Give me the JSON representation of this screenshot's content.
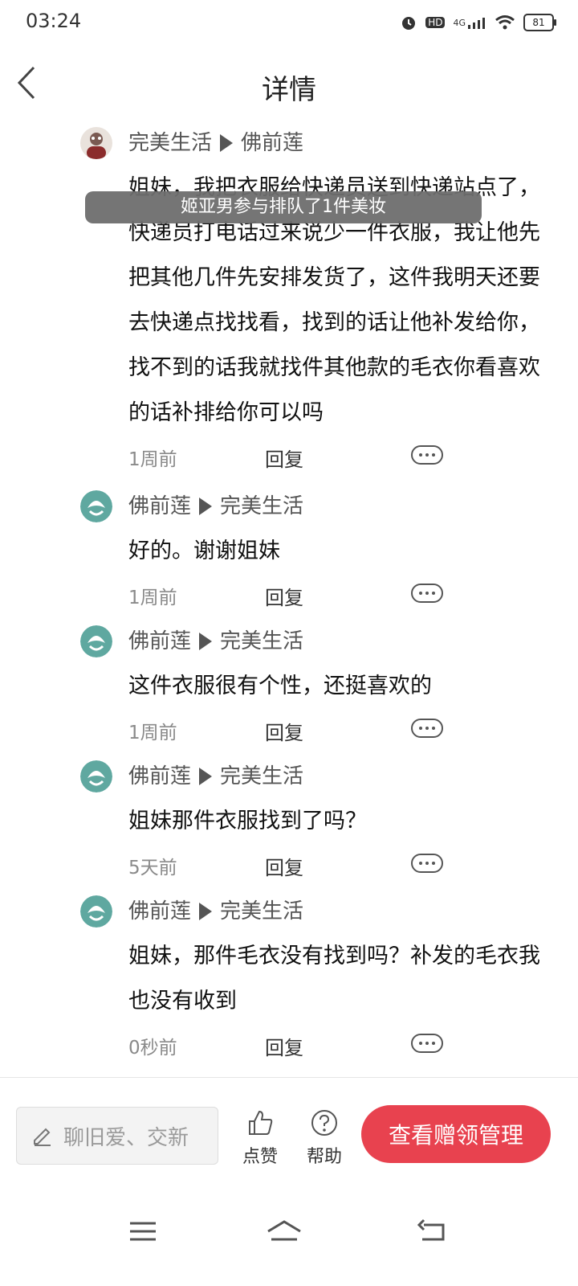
{
  "status": {
    "time": "03:24",
    "hd": "HD",
    "network": "4G",
    "battery": "81"
  },
  "header": {
    "title": "详情"
  },
  "toast": {
    "text": "姬亚男参与排队了1件美妆"
  },
  "comments": [
    {
      "author": "完美生活",
      "target": "佛前莲",
      "text": "姐妹，我把衣服给快递员送到快递站点了，快递员打电话过来说少一件衣服，我让他先把其他几件先安排发货了，这件我明天还要去快递点找找看，找到的话让他补发给你，找不到的话我就找件其他款的毛衣你看喜欢的话补排给你可以吗",
      "time": "1周前",
      "reply": "回复"
    },
    {
      "author": "佛前莲",
      "target": "完美生活",
      "text": "好的。谢谢姐妹",
      "time": "1周前",
      "reply": "回复"
    },
    {
      "author": "佛前莲",
      "target": "完美生活",
      "text": "这件衣服很有个性，还挺喜欢的",
      "time": "1周前",
      "reply": "回复"
    },
    {
      "author": "佛前莲",
      "target": "完美生活",
      "text": "姐妹那件衣服找到了吗？",
      "time": "5天前",
      "reply": "回复"
    },
    {
      "author": "佛前莲",
      "target": "完美生活",
      "text": "姐妹，那件毛衣没有找到吗？补发的毛衣我也没有收到",
      "time": "0秒前",
      "reply": "回复"
    }
  ],
  "bottom": {
    "placeholder": "聊旧爱、交新",
    "like": "点赞",
    "help": "帮助",
    "cta": "查看赠领管理"
  }
}
